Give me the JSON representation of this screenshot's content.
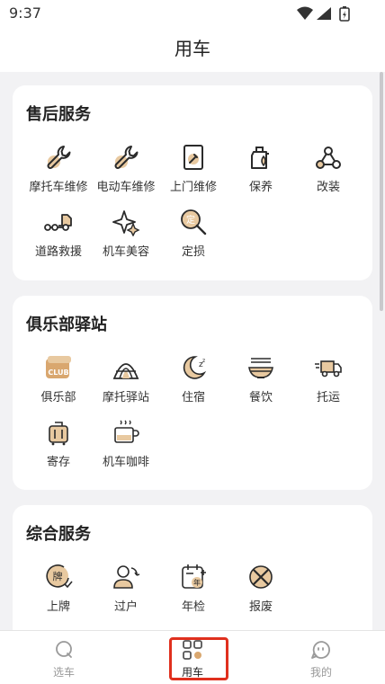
{
  "status_bar": {
    "time": "9:37"
  },
  "header": {
    "title": "用车"
  },
  "sections": [
    {
      "title": "售后服务",
      "items": [
        {
          "label": "摩托车维修",
          "icon": "wrench-icon"
        },
        {
          "label": "电动车维修",
          "icon": "wrench-icon"
        },
        {
          "label": "上门维修",
          "icon": "door-repair-icon"
        },
        {
          "label": "保养",
          "icon": "oil-can-icon"
        },
        {
          "label": "改装",
          "icon": "modify-icon"
        },
        {
          "label": "道路救援",
          "icon": "tow-truck-icon"
        },
        {
          "label": "机车美容",
          "icon": "sparkle-icon"
        },
        {
          "label": "定损",
          "icon": "magnifier-icon",
          "badge": "定"
        }
      ]
    },
    {
      "title": "俱乐部驿站",
      "items": [
        {
          "label": "俱乐部",
          "icon": "club-badge-icon",
          "badge": "CLUB"
        },
        {
          "label": "摩托驿站",
          "icon": "tent-icon"
        },
        {
          "label": "住宿",
          "icon": "moon-icon"
        },
        {
          "label": "餐饮",
          "icon": "noodle-bowl-icon"
        },
        {
          "label": "托运",
          "icon": "delivery-truck-icon"
        },
        {
          "label": "寄存",
          "icon": "luggage-icon"
        },
        {
          "label": "机车咖啡",
          "icon": "coffee-cup-icon"
        }
      ]
    },
    {
      "title": "综合服务",
      "items": [
        {
          "label": "上牌",
          "icon": "license-plate-icon",
          "badge": "牌"
        },
        {
          "label": "过户",
          "icon": "transfer-person-icon"
        },
        {
          "label": "年检",
          "icon": "calendar-inspection-icon",
          "badge": "年"
        },
        {
          "label": "报废",
          "icon": "scrap-icon"
        }
      ]
    }
  ],
  "bottom_nav": [
    {
      "label": "选车",
      "icon": "select-car-icon",
      "active": false
    },
    {
      "label": "用车",
      "icon": "use-car-grid-icon",
      "active": true
    },
    {
      "label": "我的",
      "icon": "profile-chat-icon",
      "active": false
    }
  ],
  "colors": {
    "accent": "#e8c9a0",
    "stroke": "#2b2b2b",
    "highlight": "#e0301e"
  }
}
